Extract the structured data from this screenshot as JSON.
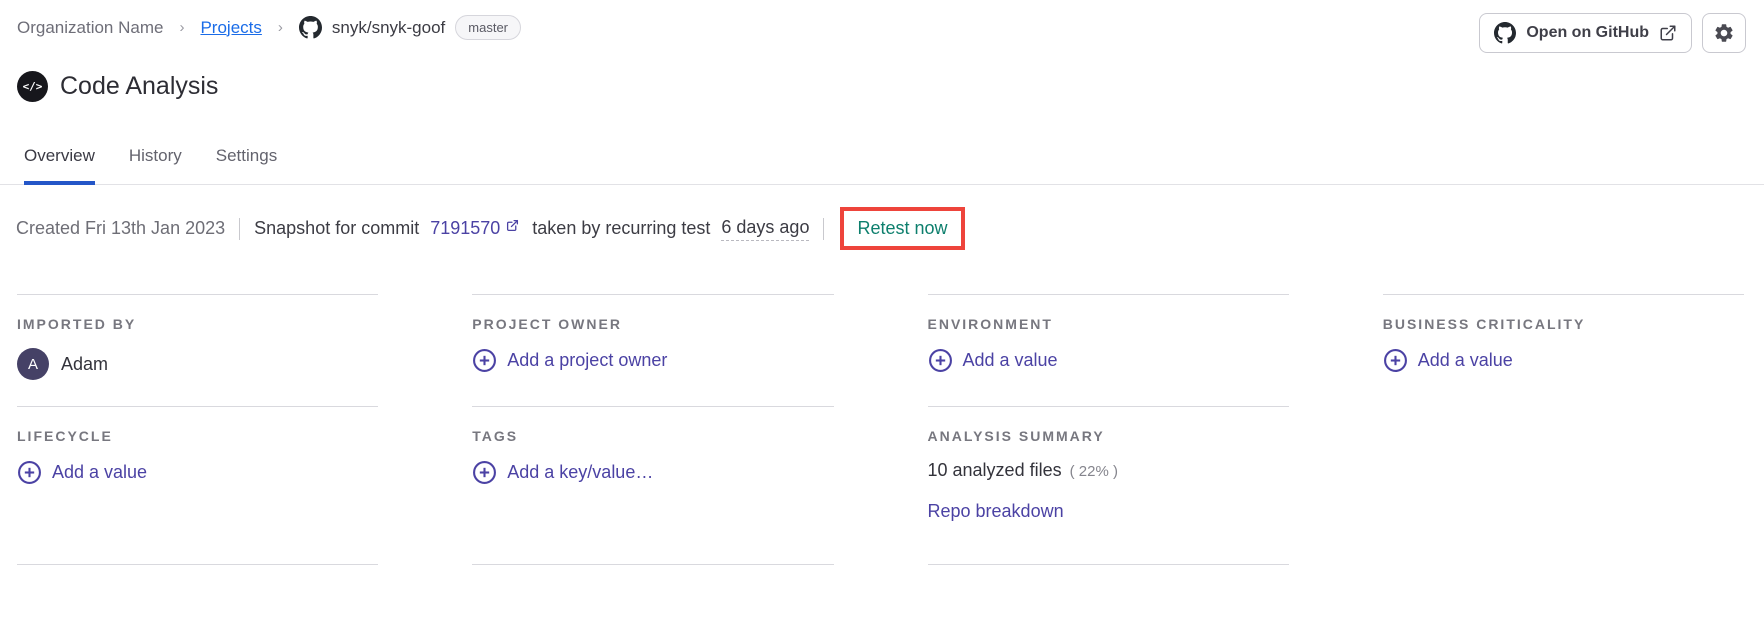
{
  "breadcrumb": {
    "org": "Organization Name",
    "projects_link": "Projects",
    "repo": "snyk/snyk-goof",
    "branch": "master"
  },
  "header_actions": {
    "open_on_github": "Open on GitHub",
    "settings_icon": "gear-icon"
  },
  "page": {
    "title": "Code Analysis",
    "icon": "code-icon"
  },
  "tabs": [
    {
      "label": "Overview",
      "active": true
    },
    {
      "label": "History",
      "active": false
    },
    {
      "label": "Settings",
      "active": false
    }
  ],
  "meta": {
    "created": "Created Fri 13th Jan 2023",
    "snapshot_prefix": "Snapshot for commit ",
    "commit": "7191570",
    "snapshot_middle": " taken by recurring test ",
    "time_ago": "6 days ago",
    "retest": "Retest now",
    "annotation_color": "#ee443b",
    "retest_color": "#0d7f6d",
    "commit_link_color": "#4b42a4"
  },
  "fields": {
    "imported_by": {
      "label": "IMPORTED BY",
      "avatar_initial": "A",
      "value": "Adam"
    },
    "project_owner": {
      "label": "PROJECT OWNER",
      "action": "Add a project owner"
    },
    "environment": {
      "label": "ENVIRONMENT",
      "action": "Add a value"
    },
    "business_criticality": {
      "label": "BUSINESS CRITICALITY",
      "action": "Add a value"
    },
    "lifecycle": {
      "label": "LIFECYCLE",
      "action": "Add a value"
    },
    "tags": {
      "label": "TAGS",
      "action": "Add a key/value…"
    },
    "analysis_summary": {
      "label": "ANALYSIS SUMMARY",
      "files": "10 analyzed files",
      "percent": "( 22% )",
      "link": "Repo breakdown"
    }
  },
  "colors": {
    "accent_blue_tab": "#2456c8",
    "link_blue": "#1a6ce8",
    "link_purple": "#4b42a4",
    "divider": "#d9d9de"
  }
}
